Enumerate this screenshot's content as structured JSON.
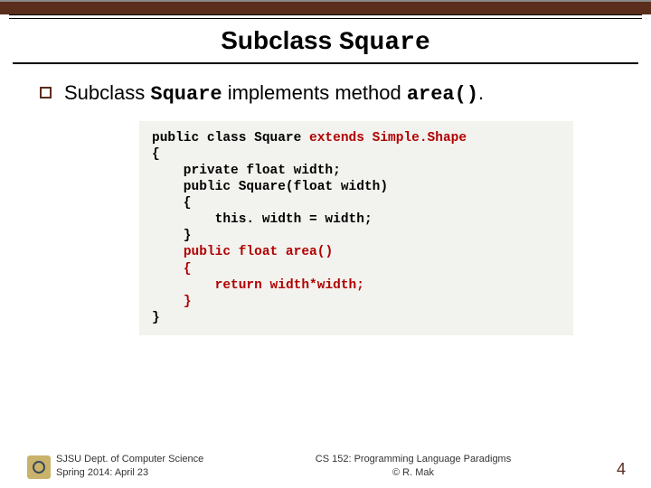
{
  "title": {
    "prefix": "Subclass ",
    "mono": "Square"
  },
  "bullet": {
    "prefix": "Subclass ",
    "mono1": "Square",
    "mid": " implements method ",
    "mono2": "area()",
    "suffix": "."
  },
  "code": {
    "l1a": "public class Square ",
    "l1b": "extends Simple.Shape",
    "l2": "{",
    "l3": "    private float width;",
    "blank1": "",
    "l4": "    public Square(float width)",
    "l5": "    {",
    "l6": "        this. width = width;",
    "l7": "    }",
    "blank2": "",
    "l8a": "    ",
    "l8b": "public float area()",
    "l9a": "    ",
    "l9b": "{",
    "l10a": "        ",
    "l10b": "return width*width;",
    "l11a": "    ",
    "l11b": "}",
    "l12": "}"
  },
  "footer": {
    "left1": "SJSU Dept. of Computer Science",
    "left2": "Spring 2014: April 23",
    "mid1": "CS 152: Programming Language Paradigms",
    "mid2": "© R. Mak",
    "page": "4"
  }
}
